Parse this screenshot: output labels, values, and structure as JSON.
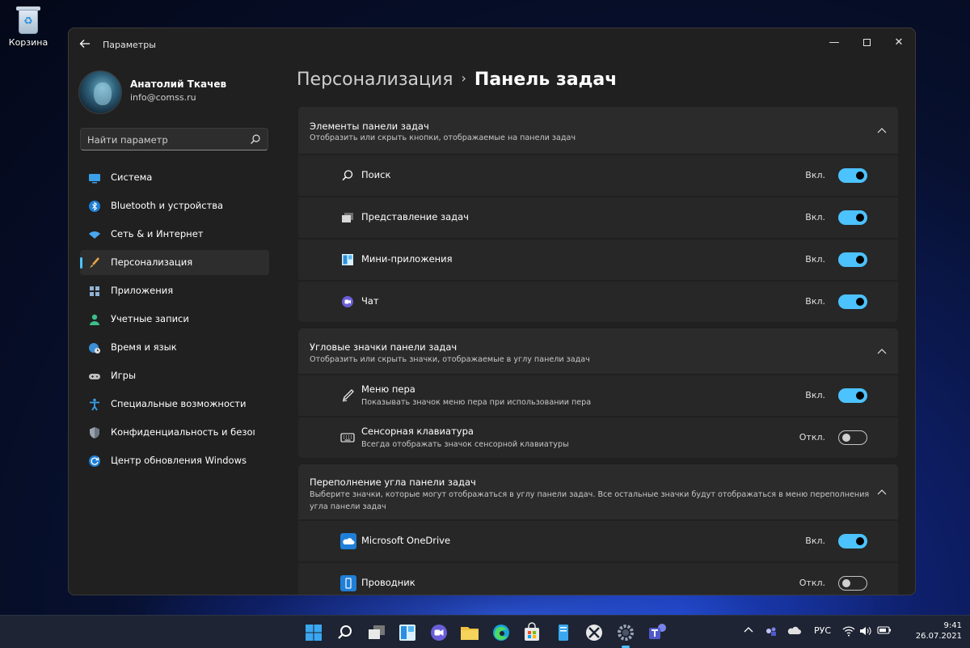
{
  "desktop": {
    "recycle_bin_label": "Корзина"
  },
  "window": {
    "title": "Параметры",
    "minimize_glyph": "—",
    "close_glyph": "✕"
  },
  "user": {
    "name": "Анатолий Ткачев",
    "email": "info@comss.ru"
  },
  "search": {
    "placeholder": "Найти параметр"
  },
  "nav": {
    "items": [
      {
        "label": "Система",
        "icon": "display-icon"
      },
      {
        "label": "Bluetooth и устройства",
        "icon": "bluetooth-icon"
      },
      {
        "label": "Сеть & и Интернет",
        "icon": "wifi-icon"
      },
      {
        "label": "Персонализация",
        "icon": "brush-icon",
        "active": true
      },
      {
        "label": "Приложения",
        "icon": "apps-icon"
      },
      {
        "label": "Учетные записи",
        "icon": "person-icon"
      },
      {
        "label": "Время и язык",
        "icon": "globe-clock-icon"
      },
      {
        "label": "Игры",
        "icon": "gamepad-icon"
      },
      {
        "label": "Специальные возможности",
        "icon": "accessibility-icon"
      },
      {
        "label": "Конфиденциальность и безопас",
        "icon": "shield-icon"
      },
      {
        "label": "Центр обновления Windows",
        "icon": "update-icon"
      }
    ]
  },
  "breadcrumb": {
    "parent": "Персонализация",
    "separator": "›",
    "current": "Панель задач"
  },
  "groups": {
    "taskbar_items": {
      "title": "Элементы панели задач",
      "description": "Отобразить или скрыть кнопки, отображаемые на панели задач",
      "rows": [
        {
          "label": "Поиск",
          "state": "Вкл.",
          "on": true,
          "icon": "search-icon"
        },
        {
          "label": "Представление задач",
          "state": "Вкл.",
          "on": true,
          "icon": "task-view-icon"
        },
        {
          "label": "Мини-приложения",
          "state": "Вкл.",
          "on": true,
          "icon": "widgets-icon"
        },
        {
          "label": "Чат",
          "state": "Вкл.",
          "on": true,
          "icon": "chat-icon"
        }
      ]
    },
    "corner_icons": {
      "title": "Угловые значки панели задач",
      "description": "Отобразить или скрыть значки, отображаемые в углу панели задач",
      "rows": [
        {
          "label": "Меню пера",
          "desc": "Показывать значок меню пера при использовании пера",
          "state": "Вкл.",
          "on": true,
          "icon": "pen-icon"
        },
        {
          "label": "Сенсорная клавиатура",
          "desc": "Всегда отображать значок сенсорной клавиатуры",
          "state": "Откл.",
          "on": false,
          "icon": "keyboard-icon"
        }
      ]
    },
    "corner_overflow": {
      "title": "Переполнение угла панели задач",
      "description": "Выберите значки, которые могут отображаться в углу панели задач. Все остальные значки будут отображаться в меню переполнения угла панели задач",
      "rows": [
        {
          "label": "Microsoft OneDrive",
          "state": "Вкл.",
          "on": true,
          "icon": "onedrive-icon"
        },
        {
          "label": "Проводник",
          "state": "Откл.",
          "on": false,
          "icon": "file-explorer-icon"
        }
      ]
    }
  },
  "taskbar": {
    "apps": [
      "start-icon",
      "search-icon",
      "task-view-icon",
      "widgets-icon",
      "chat-icon",
      "file-explorer-icon",
      "edge-icon",
      "store-icon",
      "notepad-icon",
      "xbox-icon",
      "settings-icon",
      "teams-icon"
    ],
    "tray": {
      "language": "РУС",
      "time": "9:41",
      "date": "26.07.2021"
    }
  },
  "colors": {
    "accent": "#4cc2ff",
    "window_bg": "#202020",
    "card_bg": "#272727"
  }
}
